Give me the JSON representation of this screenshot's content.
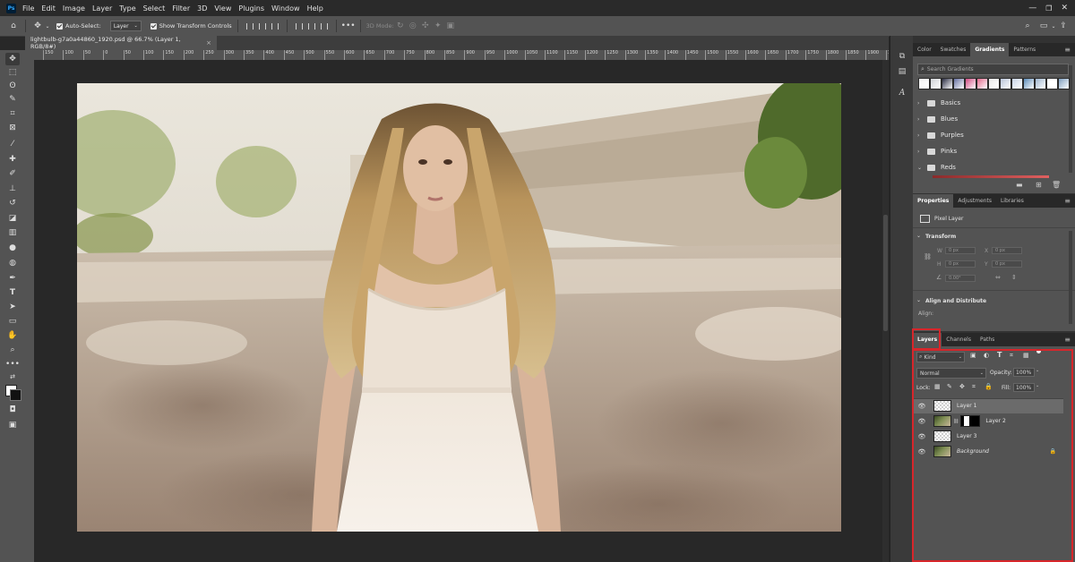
{
  "menubar": {
    "logo": "Ps",
    "items": [
      "File",
      "Edit",
      "Image",
      "Layer",
      "Type",
      "Select",
      "Filter",
      "3D",
      "View",
      "Plugins",
      "Window",
      "Help"
    ]
  },
  "options": {
    "auto_select_label": "Auto-Select:",
    "auto_select_value": "Layer",
    "transform_label": "Show Transform Controls",
    "mode_3d": "3D Mode:"
  },
  "document": {
    "tab_title": "lightbulb-g7a0a44860_1920.psd @ 66.7% (Layer 1, RGB/8#)",
    "close": "×"
  },
  "ruler": {
    "marks": [
      "150",
      "100",
      "50",
      "0",
      "50",
      "100",
      "150",
      "200",
      "250",
      "300",
      "350",
      "400",
      "450",
      "500",
      "550",
      "600",
      "650",
      "700",
      "750",
      "800",
      "850",
      "900",
      "950",
      "1000",
      "1050",
      "1100",
      "1150",
      "1200",
      "1250",
      "1300",
      "1350",
      "1400",
      "1450",
      "1500",
      "1550",
      "1600",
      "1650",
      "1700",
      "1750",
      "1800",
      "1850",
      "1900",
      "1950",
      "2000",
      "2050"
    ]
  },
  "gradients_panel": {
    "tabs": [
      "Color",
      "Swatches",
      "Gradients",
      "Patterns"
    ],
    "active_tab": "Gradients",
    "search_placeholder": "Search Gradients",
    "swatch_colors": [
      "#f3f3f3",
      "#cfd2d6",
      "#2c2f45",
      "#6670a1",
      "#d24a82",
      "#e26a8e",
      "#e9e9e9",
      "#b9c4d8",
      "#c8d4e6",
      "#5b8bb8",
      "#9fb6cf",
      "#ffffff",
      "#7f9fbf"
    ],
    "folders": [
      "Basics",
      "Blues",
      "Purples",
      "Pinks",
      "Reds"
    ]
  },
  "properties_panel": {
    "tabs": [
      "Properties",
      "Adjustments",
      "Libraries"
    ],
    "active_tab": "Properties",
    "kind": "Pixel Layer",
    "transform_header": "Transform",
    "w_label": "W",
    "h_label": "H",
    "x_label": "X",
    "y_label": "Y",
    "w_value": "0 px",
    "h_value": "0 px",
    "x_value": "0 px",
    "y_value": "0 px",
    "angle_value": "0.00°",
    "align_header": "Align and Distribute",
    "align_label": "Align:"
  },
  "layers_panel": {
    "tabs": [
      "Layers",
      "Channels",
      "Paths"
    ],
    "active_tab": "Layers",
    "filter_kind": "Kind",
    "blend_mode": "Normal",
    "opacity_label": "Opacity:",
    "opacity_value": "100%",
    "lock_label": "Lock:",
    "fill_label": "Fill:",
    "fill_value": "100%",
    "layers": [
      {
        "name": "Layer 1",
        "selected": true,
        "thumb": "transparent"
      },
      {
        "name": "Layer 2",
        "selected": false,
        "thumb": "photo-mask"
      },
      {
        "name": "Layer 3",
        "selected": false,
        "thumb": "transparent"
      },
      {
        "name": "Background",
        "selected": false,
        "thumb": "photo",
        "locked": true
      }
    ]
  },
  "colors": {
    "highlight": "#d7262b",
    "foreground": "#ffffff",
    "background": "#111111"
  }
}
